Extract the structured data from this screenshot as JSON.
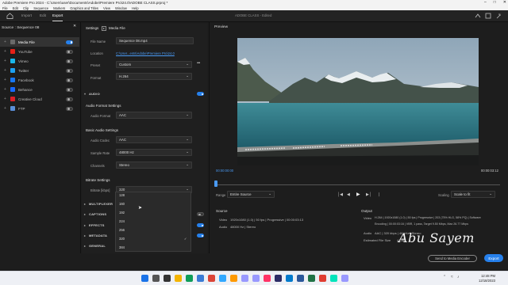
{
  "titlebar": {
    "title": "Adobe Premiere Pro 2024 - C:\\Users\\user\\Documents\\Adobe\\Premiere Pro\\24.0\\ADOBE CLASS.prproj *"
  },
  "menu": [
    "File",
    "Edit",
    "Clip",
    "Sequence",
    "Markers",
    "Graphics and Titles",
    "View",
    "Window",
    "Help"
  ],
  "header": {
    "tabs": [
      "Import",
      "Edit",
      "Export"
    ],
    "active_tab": "Export",
    "project_name": "ADOBE CLASS",
    "project_state": "- Edited"
  },
  "source": {
    "title": "Source : Sequence 08",
    "items": [
      {
        "label": "Media File",
        "color": "#6a6a6a",
        "on": true
      },
      {
        "label": "YouTube",
        "color": "#e62117",
        "on": false
      },
      {
        "label": "Vimeo",
        "color": "#1ab7ea",
        "on": false
      },
      {
        "label": "Twitter",
        "color": "#1da1f2",
        "on": false
      },
      {
        "label": "Facebook",
        "color": "#1877f2",
        "on": false
      },
      {
        "label": "Behance",
        "color": "#1769ff",
        "on": false
      },
      {
        "label": "Creative Cloud",
        "color": "#da1f26",
        "on": false
      },
      {
        "label": "FTP",
        "color": "#5a8fd8",
        "on": false
      }
    ]
  },
  "settings": {
    "title": "Settings",
    "media_file_label": "Media File",
    "file_name_label": "File Name",
    "file_name": "Sequence 08.mp4",
    "location_label": "Location",
    "location": "C:\\User...ents\\Adobe\\Premiere Pro\\24.0",
    "preset_label": "Preset",
    "preset": "Custom",
    "format_label": "Format",
    "format": "H.264",
    "audio_section": "AUDIO",
    "audio_format_settings": "Audio Format Settings",
    "audio_format_label": "Audio Format",
    "audio_format": "AAC",
    "basic_audio_settings": "Basic Audio Settings",
    "audio_codec_label": "Audio Codec",
    "audio_codec": "AAC",
    "sample_rate_label": "Sample Rate",
    "sample_rate": "48000 Hz",
    "channels_label": "Channels",
    "channels": "Stereo",
    "bitrate_settings": "Bitrate Settings",
    "bitrate_label": "Bitrate [kbps]",
    "bitrate": "320",
    "collapsed_sections": [
      "MULTIPLEXER",
      "CAPTIONS",
      "EFFECTS",
      "METADATA",
      "GENERAL"
    ],
    "bitrate_options": [
      "128",
      "160",
      "192",
      "224",
      "256",
      "320",
      "384"
    ],
    "selected_option": "320"
  },
  "preview": {
    "title": "Preview",
    "time_start": "00:00:00:00",
    "time_end": "00:00:03:12",
    "range_label": "Range",
    "range_value": "Entire Source",
    "scaling_label": "Scaling",
    "scaling_value": "Scale to fit",
    "progress": 0.0
  },
  "source_info": {
    "title": "Source",
    "video_label": "Video",
    "video": "1920x1080 (1.0) | 50 fps | Progressive | 00:00:03:13",
    "audio_label": "Audio",
    "audio": "48000 Hz | Stereo"
  },
  "output_info": {
    "title": "Output",
    "video_label": "Video",
    "video": "H.264 | 1920x1080 (1.0) | 50 fps | Progressive | 203 (75% HLG, 58% PQ) | Software",
    "encoding": "Encoding | 00:00:03:16 | VBR, 1 pass, Target 9.50 Mbps, Max 26.77 Mbps",
    "audio_label": "Audio",
    "audio": "AAC | 320 kbps | 48 kHz | Stereo",
    "file_size_label": "Estimated File Size",
    "file_size": "4 MB"
  },
  "buttons": {
    "send": "Send to Media Encoder",
    "export": "Export"
  },
  "watermark": "Abu Sayem",
  "taskbar": {
    "time": "12:48 PM",
    "date": "12/18/2023",
    "icons": [
      {
        "name": "windows-icon",
        "color": "#1a73e8"
      },
      {
        "name": "search-icon",
        "color": "#555"
      },
      {
        "name": "taskview-icon",
        "color": "#333"
      },
      {
        "name": "explorer-icon",
        "color": "#f4b400"
      },
      {
        "name": "edge-icon",
        "color": "#0f9d58"
      },
      {
        "name": "store-icon",
        "color": "#3a7bd5"
      },
      {
        "name": "chrome-icon",
        "color": "#db4437"
      },
      {
        "name": "photoshop-icon",
        "color": "#31a8ff"
      },
      {
        "name": "illustrator-icon",
        "color": "#ff9a00"
      },
      {
        "name": "premiere-icon",
        "color": "#9999ff"
      },
      {
        "name": "aftereffects-icon",
        "color": "#9999ff"
      },
      {
        "name": "indesign-icon",
        "color": "#ff3366"
      },
      {
        "name": "mediaencoder-icon",
        "color": "#2c2c66"
      },
      {
        "name": "vscode-icon",
        "color": "#007acc"
      },
      {
        "name": "word-icon",
        "color": "#2b579a"
      },
      {
        "name": "excel-icon",
        "color": "#217346"
      },
      {
        "name": "acrobat-icon",
        "color": "#e03c31"
      },
      {
        "name": "audition-icon",
        "color": "#00e4bb"
      },
      {
        "name": "premiere2-icon",
        "color": "#9999ff"
      }
    ]
  }
}
